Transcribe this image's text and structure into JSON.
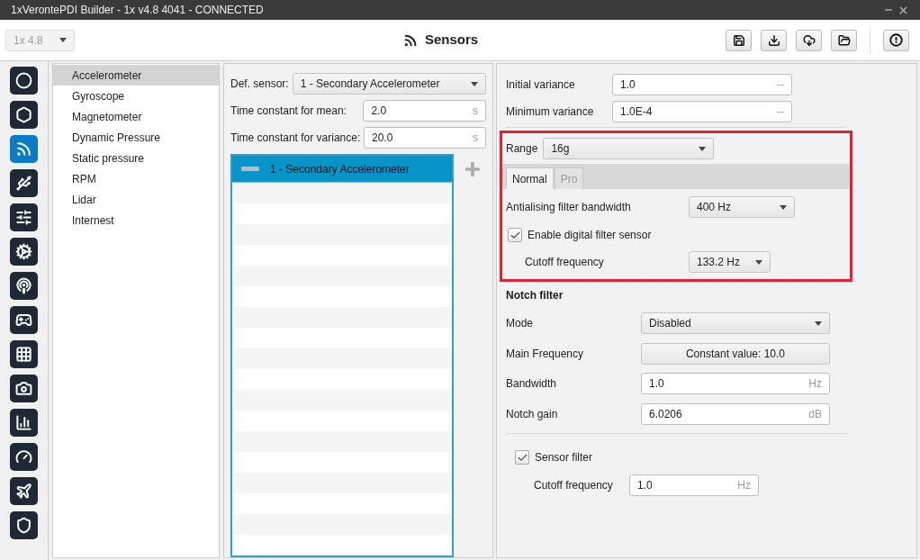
{
  "window": {
    "title": "1xVerontePDI Builder - 1x v4.8 4041 - CONNECTED"
  },
  "header": {
    "version_select": {
      "value": "1x 4.8",
      "disabled": true
    },
    "title": "Sensors"
  },
  "nav_icons": [
    {
      "kind": "ring",
      "selected": false
    },
    {
      "kind": "hexagon",
      "selected": false
    },
    {
      "kind": "signal",
      "selected": true
    },
    {
      "kind": "usb",
      "selected": false
    },
    {
      "kind": "sliders",
      "selected": false
    },
    {
      "kind": "gears",
      "selected": false
    },
    {
      "kind": "broadcast",
      "selected": false
    },
    {
      "kind": "gamepad",
      "selected": false
    },
    {
      "kind": "grid",
      "selected": false
    },
    {
      "kind": "camera",
      "selected": false
    },
    {
      "kind": "chart",
      "selected": false
    },
    {
      "kind": "gauge",
      "selected": false
    },
    {
      "kind": "plane",
      "selected": false
    },
    {
      "kind": "shield",
      "selected": false
    }
  ],
  "sensor_menu": [
    {
      "label": "Accelerometer",
      "selected": true
    },
    {
      "label": "Gyroscope",
      "selected": false
    },
    {
      "label": "Magnetometer",
      "selected": false
    },
    {
      "label": "Dynamic Pressure",
      "selected": false
    },
    {
      "label": "Static pressure",
      "selected": false
    },
    {
      "label": "RPM",
      "selected": false
    },
    {
      "label": "Lidar",
      "selected": false
    },
    {
      "label": "Internest",
      "selected": false
    }
  ],
  "sensor_config": {
    "def_sensor": {
      "label": "Def. sensor:",
      "value": "1 - Secondary Accelerometer"
    },
    "fields": [
      {
        "label": "Time constant for mean:",
        "value": "2.0",
        "unit": "s"
      },
      {
        "label": "Time constant for variance:",
        "value": "20.0",
        "unit": "s"
      }
    ],
    "sensor_list": [
      {
        "label": "1 - Secondary Accelerometer",
        "selected": true
      }
    ]
  },
  "variance": [
    {
      "label": "Initial variance",
      "value": "1.0",
      "unit": "--"
    },
    {
      "label": "Minimum variance",
      "value": "1.0E-4",
      "unit": "--"
    }
  ],
  "range": {
    "label": "Range",
    "value": "16g"
  },
  "tabs": [
    {
      "label": "Normal",
      "selected": true,
      "disabled": false
    },
    {
      "label": "Pro",
      "selected": false,
      "disabled": true
    }
  ],
  "antialiasing": {
    "label": "Antialising filter bandwidth",
    "value": "400 Hz"
  },
  "digital_filter": {
    "label": "Enable digital filter sensor",
    "checked": true
  },
  "digital_cutoff": {
    "label": "Cutoff frequency",
    "value": "133.2 Hz"
  },
  "notch_filter": {
    "title": "Notch filter",
    "mode": {
      "label": "Mode",
      "value": "Disabled"
    },
    "main_frequency": {
      "label": "Main Frequency",
      "value": "Constant value: 10.0"
    },
    "bandwidth": {
      "label": "Bandwidth",
      "value": "1.0",
      "unit": "Hz"
    },
    "gain": {
      "label": "Notch gain",
      "value": "6.0206",
      "unit": "dB"
    }
  },
  "sensor_filter": {
    "label": "Sensor filter",
    "checked": true
  },
  "sensor_cutoff": {
    "label": "Cutoff frequency",
    "value": "1.0",
    "unit": "Hz"
  }
}
